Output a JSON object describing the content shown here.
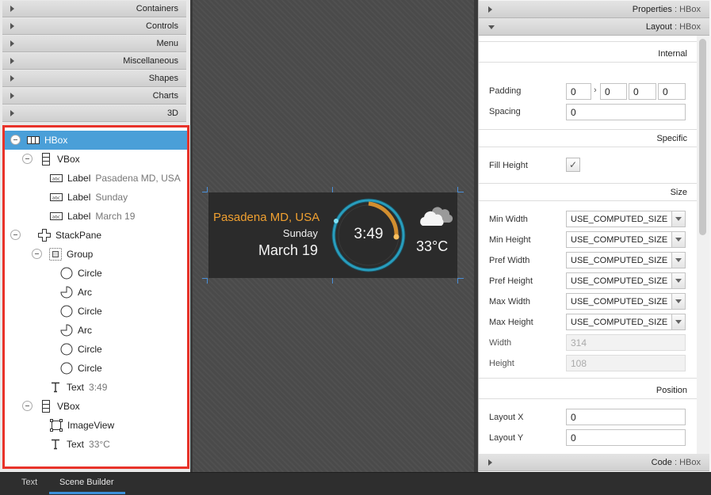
{
  "library": {
    "sections": [
      "Containers",
      "Controls",
      "Menu",
      "Miscellaneous",
      "Shapes",
      "Charts",
      "3D"
    ]
  },
  "hierarchy": {
    "nodes": [
      {
        "type": "HBox",
        "value": ""
      },
      {
        "type": "VBox",
        "value": ""
      },
      {
        "type": "Label",
        "value": "Pasadena MD, USA"
      },
      {
        "type": "Label",
        "value": "Sunday"
      },
      {
        "type": "Label",
        "value": "March 19"
      },
      {
        "type": "StackPane",
        "value": ""
      },
      {
        "type": "Group",
        "value": ""
      },
      {
        "type": "Circle",
        "value": ""
      },
      {
        "type": "Arc",
        "value": ""
      },
      {
        "type": "Circle",
        "value": ""
      },
      {
        "type": "Arc",
        "value": ""
      },
      {
        "type": "Circle",
        "value": ""
      },
      {
        "type": "Circle",
        "value": ""
      },
      {
        "type": "Text",
        "value": "3:49"
      },
      {
        "type": "VBox",
        "value": ""
      },
      {
        "type": "ImageView",
        "value": ""
      },
      {
        "type": "Text",
        "value": "33°C"
      }
    ]
  },
  "widget": {
    "city": "Pasadena MD, USA",
    "day": "Sunday",
    "date": "March 19",
    "time": "3:49",
    "temperature": "33°C",
    "accent_color": "#f0a030",
    "ring_color": "#2aa6c8",
    "icon": "cloud-icon"
  },
  "inspector": {
    "properties_header": {
      "title": "Properties",
      "sep": " : ",
      "type": "HBox"
    },
    "layout_header": {
      "title": "Layout",
      "sep": " : ",
      "type": "HBox"
    },
    "code_header": {
      "title": "Code",
      "sep": " : ",
      "type": "HBox"
    },
    "internal": {
      "title": "Internal",
      "padding_label": "Padding",
      "padding_values": [
        "0",
        "0",
        "0",
        "0"
      ],
      "spacing_label": "Spacing",
      "spacing_value": "0"
    },
    "specific": {
      "title": "Specific",
      "fill_height_label": "Fill Height",
      "fill_height_checked": true
    },
    "size": {
      "title": "Size",
      "min_width_label": "Min Width",
      "min_width": "USE_COMPUTED_SIZE",
      "min_height_label": "Min Height",
      "min_height": "USE_COMPUTED_SIZE",
      "pref_width_label": "Pref Width",
      "pref_width": "USE_COMPUTED_SIZE",
      "pref_height_label": "Pref Height",
      "pref_height": "USE_COMPUTED_SIZE",
      "max_width_label": "Max Width",
      "max_width": "USE_COMPUTED_SIZE",
      "max_height_label": "Max Height",
      "max_height": "USE_COMPUTED_SIZE",
      "width_label": "Width",
      "width": "314",
      "height_label": "Height",
      "height": "108"
    },
    "position": {
      "title": "Position",
      "layout_x_label": "Layout X",
      "layout_x": "0",
      "layout_y_label": "Layout Y",
      "layout_y": "0"
    }
  },
  "bottom_tabs": [
    "Text",
    "Scene Builder"
  ],
  "colors": {
    "selection": "#4a9fd8",
    "highlight_border": "#e8332a",
    "tab_underline": "#3b8fd9"
  }
}
